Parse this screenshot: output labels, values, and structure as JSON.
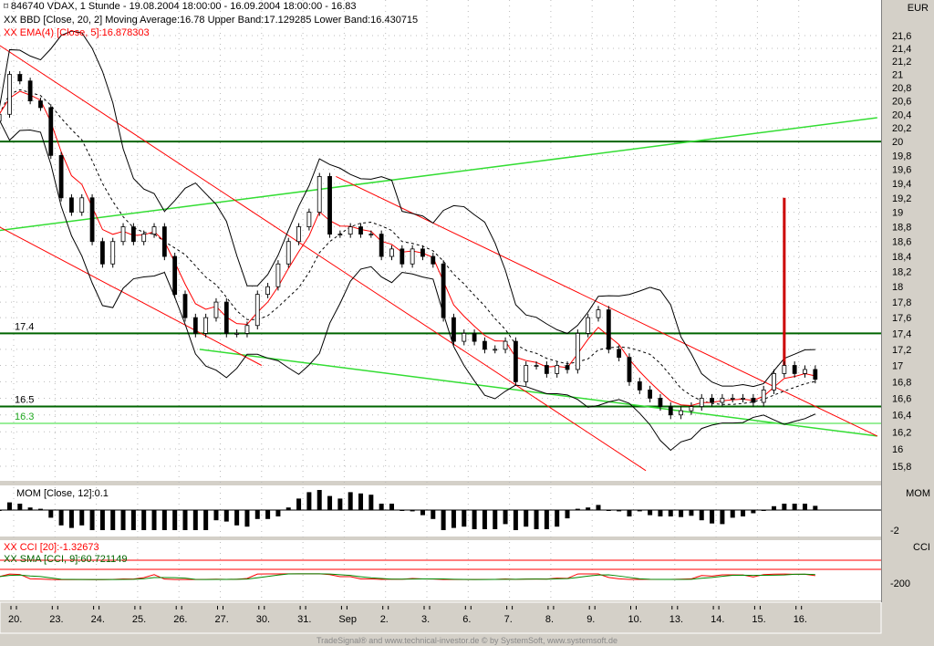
{
  "header": {
    "title": "846740  VDAX, 1 Stunde - 19.08.2004 18:00:00 - 16.09.2004 18:00:00 - 16.83",
    "bbd": "XX BBD [Close, 20, 2] Moving Average:16.78 Upper Band:17.129285 Lower Band:16.430715",
    "ema": "XX EMA(4) [Close, 5]:16.878303"
  },
  "axis": {
    "currency": "EUR",
    "mom_label": "MOM",
    "cci_label": "CCI",
    "mom_tick": "-2",
    "cci_tick": "-200"
  },
  "mom": {
    "legend": "MOM [Close, 12]:0.1"
  },
  "cci": {
    "legend": "XX CCI [20]:-1.32673",
    "sma_legend": "XX SMA [CCI, 9]:60.721149"
  },
  "footer": "TradeSignal® and www.technical-investor.de © by SystemSoft, www.systemsoft.de",
  "colors": {
    "up": "#ffffff",
    "down": "#000000",
    "ema": "#ff0000",
    "hline": "#006400",
    "trend_green": "#33dd33",
    "trend_red": "#ff0000",
    "panel": "#d4d0c8"
  },
  "chart_data": {
    "type": "candlestick",
    "scale": "log",
    "ylim": [
      15.8,
      21.6
    ],
    "yticks": [
      21.6,
      21.4,
      21.2,
      21,
      20.8,
      20.6,
      20.4,
      20.2,
      20,
      19.8,
      19.6,
      19.4,
      19.2,
      19,
      18.8,
      18.6,
      18.4,
      18.2,
      18,
      17.8,
      17.6,
      17.4,
      17.2,
      17,
      16.8,
      16.6,
      16.4,
      16.2,
      16,
      15.8
    ],
    "x_labels": [
      "20.",
      "23.",
      "24.",
      "25.",
      "26.",
      "27.",
      "30.",
      "31.",
      "Sep",
      "2.",
      "3.",
      "6.",
      "7.",
      "8.",
      "9.",
      "10.",
      "13.",
      "14.",
      "15.",
      "16."
    ],
    "bars_per_day": 4,
    "closes": [
      20.4,
      21.0,
      20.9,
      20.6,
      20.5,
      19.8,
      19.2,
      19.0,
      19.2,
      18.6,
      18.3,
      18.6,
      18.8,
      18.6,
      18.7,
      18.8,
      18.4,
      17.9,
      17.6,
      17.4,
      17.6,
      17.8,
      17.4,
      17.4,
      17.5,
      17.9,
      18.0,
      18.3,
      18.6,
      18.8,
      19.0,
      19.5,
      18.7,
      18.7,
      18.8,
      18.7,
      18.7,
      18.4,
      18.5,
      18.3,
      18.5,
      18.4,
      18.3,
      17.6,
      17.3,
      17.4,
      17.3,
      17.2,
      17.2,
      17.3,
      16.8,
      17.0,
      17.0,
      16.9,
      17.0,
      16.95,
      17.4,
      17.6,
      17.7,
      17.2,
      17.1,
      16.8,
      16.7,
      16.6,
      16.5,
      16.4,
      16.45,
      16.5,
      16.6,
      16.55,
      16.6,
      16.6,
      16.6,
      16.55,
      16.7,
      16.9,
      17.0,
      16.9,
      16.95,
      16.83
    ],
    "spike": {
      "bar": 76,
      "high": 19.2
    },
    "hlines": [
      {
        "value": 20,
        "label": ""
      },
      {
        "value": 17.4,
        "label": "17.4"
      },
      {
        "value": 16.5,
        "label": "16.5"
      },
      {
        "value": 16.3,
        "label": "16.3"
      }
    ],
    "trendlines": [
      {
        "color": "green",
        "from": [
          -0.35,
          18.75
        ],
        "to": [
          20.9,
          20.35
        ]
      },
      {
        "color": "green",
        "from": [
          4.5,
          17.2
        ],
        "to": [
          20.9,
          16.15
        ]
      },
      {
        "color": "red",
        "from": [
          -0.35,
          21.45
        ],
        "to": [
          15.3,
          15.75
        ]
      },
      {
        "color": "red",
        "from": [
          -0.35,
          18.8
        ],
        "to": [
          6.0,
          17.0
        ]
      },
      {
        "color": "red",
        "from": [
          7.8,
          19.5
        ],
        "to": [
          20.9,
          16.15
        ]
      }
    ]
  }
}
